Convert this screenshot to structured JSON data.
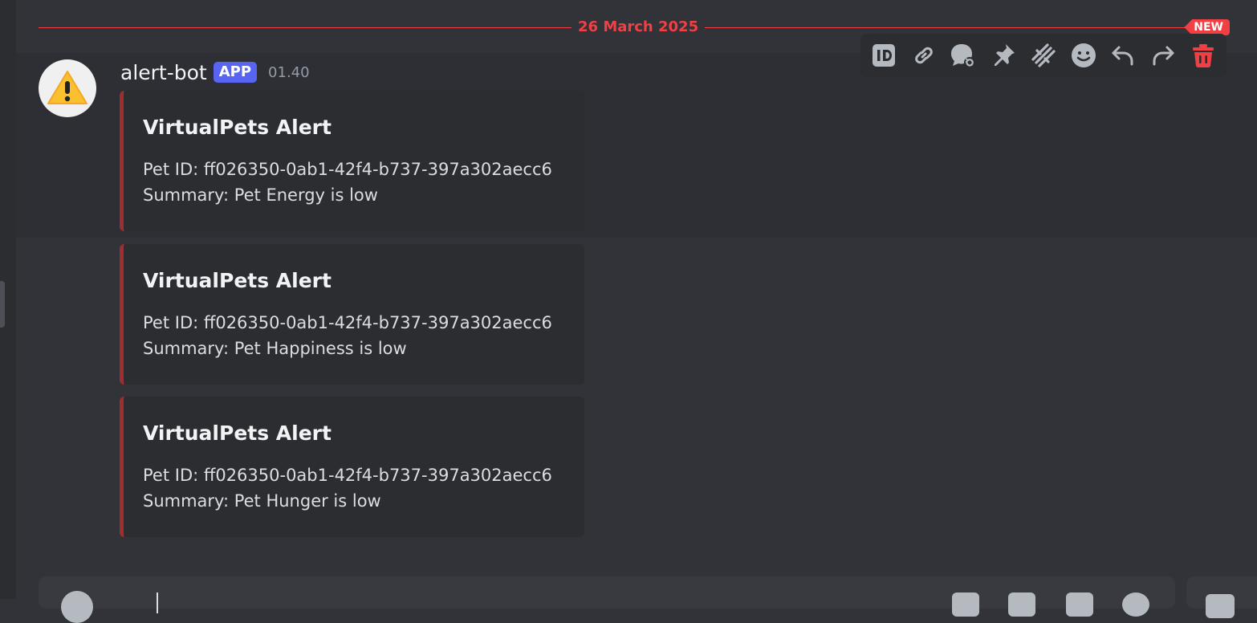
{
  "divider": {
    "date": "26 March 2025",
    "new_badge": "NEW"
  },
  "message": {
    "username": "alert-bot",
    "app_tag": "APP",
    "timestamp": "01.40",
    "avatar_icon": "warning-icon",
    "embeds": [
      {
        "title": "VirtualPets Alert",
        "pet_id": "Pet ID: ff026350-0ab1-42f4-b737-397a302aecc6",
        "summary": "Summary: Pet Energy is low"
      },
      {
        "title": "VirtualPets Alert",
        "pet_id": "Pet ID: ff026350-0ab1-42f4-b737-397a302aecc6",
        "summary": "Summary: Pet Happiness is low"
      },
      {
        "title": "VirtualPets Alert",
        "pet_id": "Pet ID: ff026350-0ab1-42f4-b737-397a302aecc6",
        "summary": "Summary: Pet Hunger is low"
      }
    ]
  },
  "toolbar": {
    "icons": [
      "id-icon",
      "link-icon",
      "thread-icon",
      "pin-icon",
      "apps-icon",
      "emoji-icon",
      "reply-icon",
      "forward-icon",
      "delete-icon"
    ]
  },
  "colors": {
    "background": "#323339",
    "accent_red": "#f23f43",
    "embed_border": "#a12d2f",
    "app_tag": "#5865f2"
  }
}
